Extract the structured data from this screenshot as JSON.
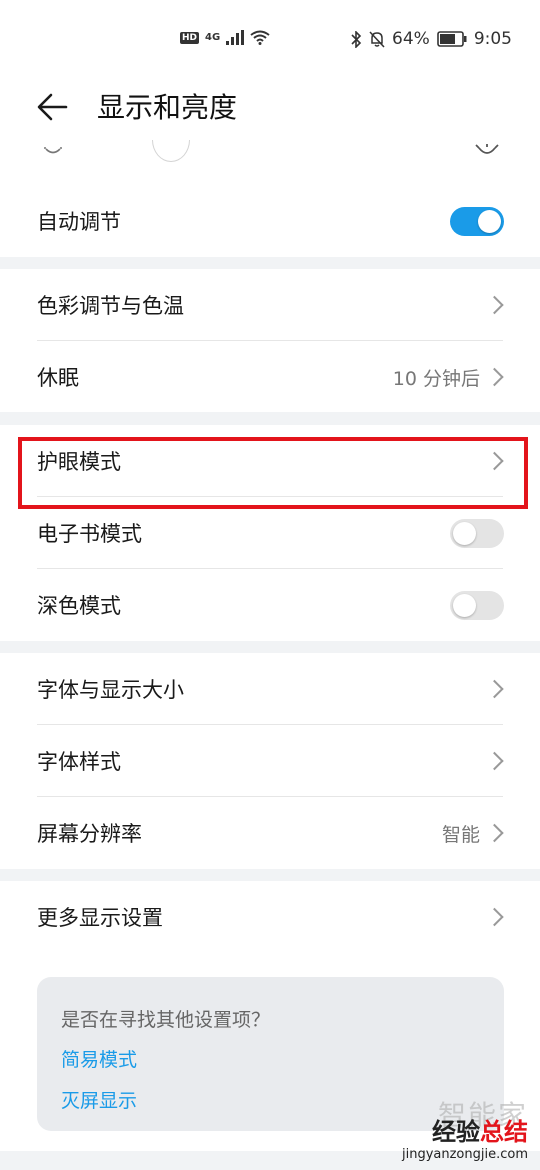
{
  "status_bar": {
    "hd": "HD",
    "network": "4G",
    "battery": "64%",
    "time": "9:05"
  },
  "header": {
    "title": "显示和亮度"
  },
  "brightness": {
    "auto_label": "自动调节",
    "auto_on": true
  },
  "section1": {
    "color_temp": "色彩调节与色温",
    "sleep_label": "休眠",
    "sleep_value": "10 分钟后"
  },
  "section2": {
    "eye_comfort": "护眼模式",
    "ebook_mode": "电子书模式",
    "ebook_on": false,
    "dark_mode": "深色模式",
    "dark_on": false
  },
  "section3": {
    "font_size": "字体与显示大小",
    "font_style": "字体样式",
    "resolution_label": "屏幕分辨率",
    "resolution_value": "智能"
  },
  "section4": {
    "more_display": "更多显示设置"
  },
  "suggestion_card": {
    "title": "是否在寻找其他设置项？",
    "links": [
      "简易模式",
      "灭屏显示"
    ]
  },
  "watermark": {
    "cn_faint": "智能家",
    "brand_black": "经验",
    "brand_red": "总结",
    "url": "jingyanzongjie.com"
  },
  "colors": {
    "accent": "#1a9be8",
    "highlight": "#e3141b"
  }
}
